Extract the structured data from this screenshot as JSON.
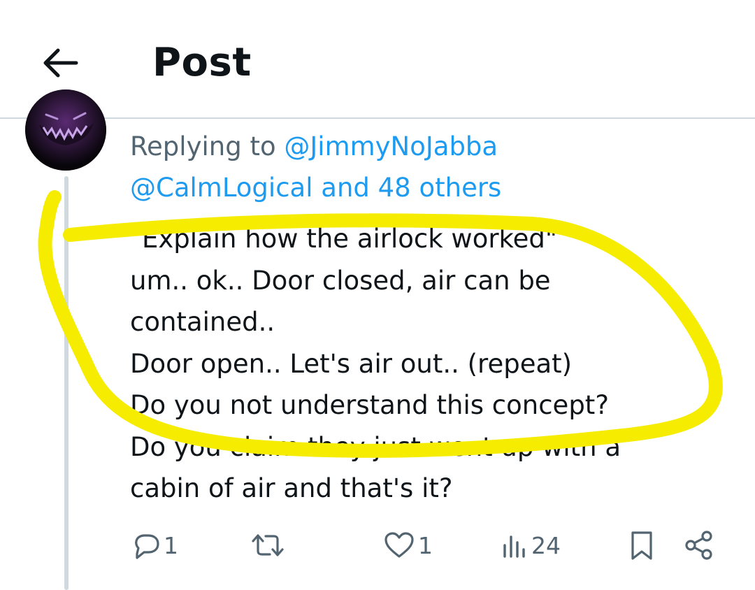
{
  "header": {
    "title": "Post",
    "back_icon": "arrow-left-icon"
  },
  "reply": {
    "prefix": "Replying to",
    "mention_1": "@JimmyNoJabba",
    "mention_2": "@CalmLogical",
    "suffix": "and 48 others"
  },
  "post": {
    "lines": [
      "\"Explain how the airlock worked\"",
      "um.. ok.. Door closed, air can be",
      "contained..",
      "Door open.. Let's air out.. (repeat)",
      "Do you not understand this concept?",
      "Do you claim they just went up with a",
      "cabin of air and that's it?"
    ]
  },
  "actions": {
    "replies": {
      "count": "1",
      "icon": "reply-icon"
    },
    "reposts": {
      "count": "",
      "icon": "repost-icon"
    },
    "likes": {
      "count": "1",
      "icon": "heart-icon"
    },
    "views": {
      "count": "24",
      "icon": "views-icon"
    },
    "bookmark": {
      "icon": "bookmark-icon"
    },
    "share": {
      "icon": "share-icon"
    }
  },
  "colors": {
    "accent": "#1d9bf0",
    "muted": "#536471",
    "highlight": "#f5ec00"
  }
}
